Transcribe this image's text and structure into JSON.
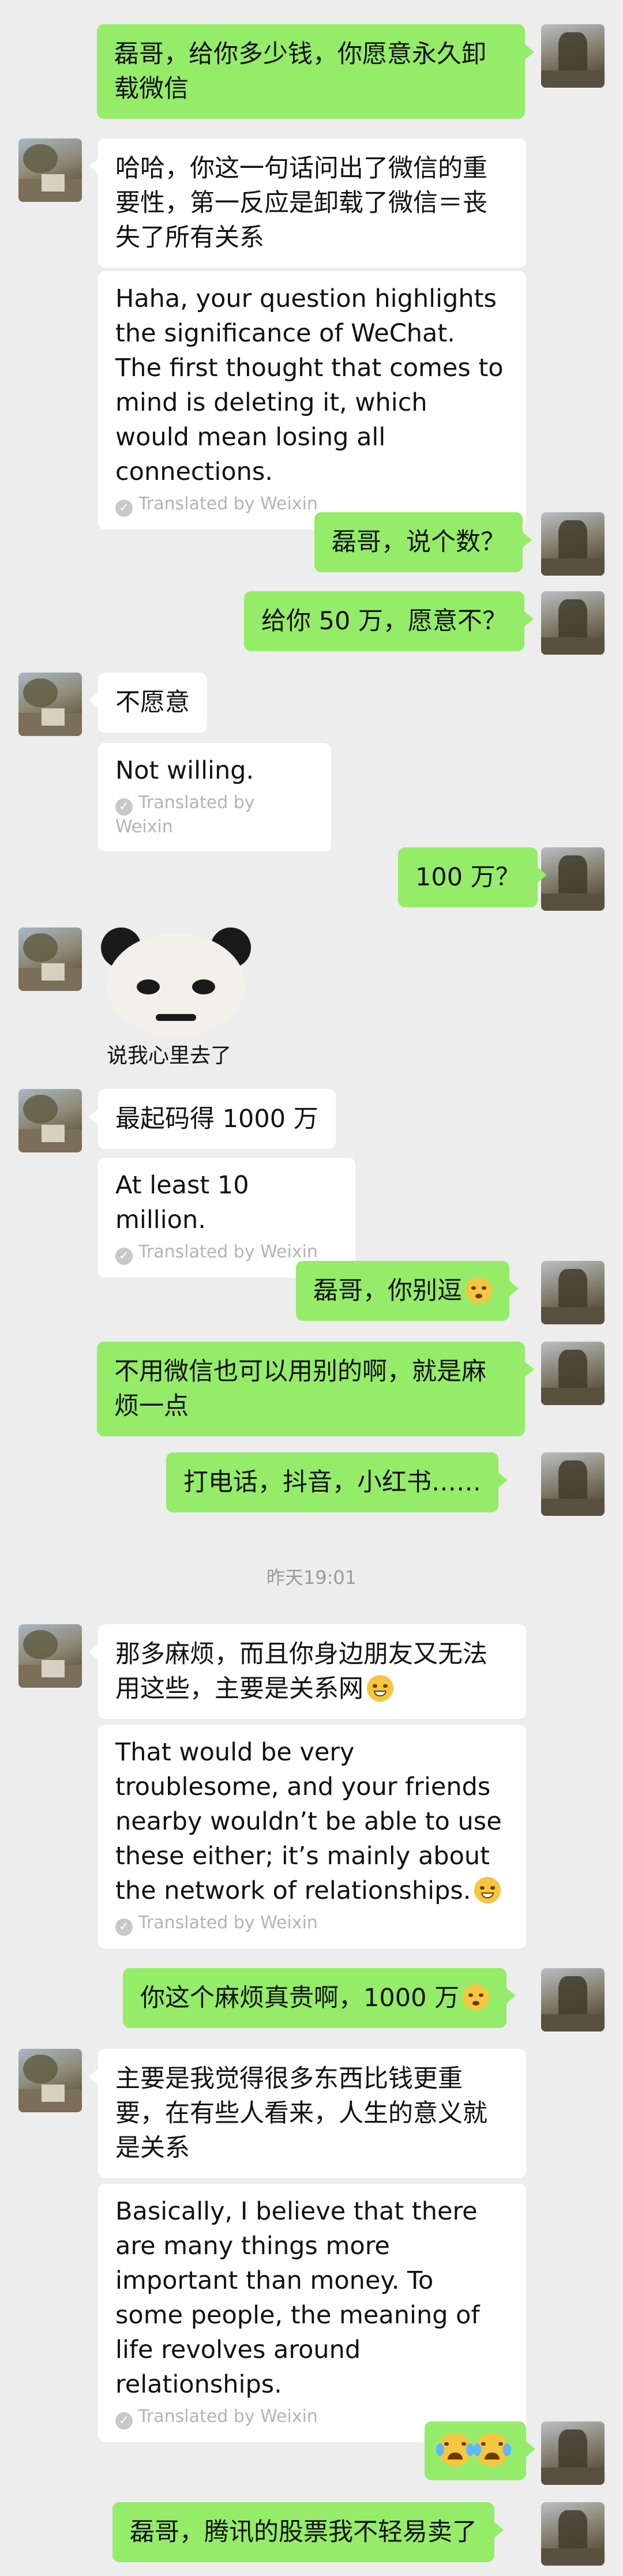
{
  "messages": [
    {
      "side": "right",
      "text": "磊哥，给你多少钱，你愿意永久卸载微信"
    },
    {
      "side": "left",
      "text": "哈哈，你这一句话问出了微信的重要性，第一反应是卸载了微信＝丧失了所有关系",
      "translation": "Haha, your question highlights the significance of WeChat. The first thought that comes to mind is deleting it, which would mean losing all connections."
    },
    {
      "side": "right",
      "text": "磊哥，说个数？"
    },
    {
      "side": "right",
      "text": "给你 50 万，愿意不？"
    },
    {
      "side": "left",
      "text": "不愿意",
      "translation": "Not willing."
    },
    {
      "side": "right",
      "text": "100 万？"
    },
    {
      "side": "left",
      "sticker_caption": "说我心里去了"
    },
    {
      "side": "left",
      "text": "最起码得 1000 万",
      "translation": "At least 10 million."
    },
    {
      "side": "right",
      "text": "磊哥，你别逗"
    },
    {
      "side": "right",
      "text": "不用微信也可以用别的啊，就是麻烦一点"
    },
    {
      "side": "right",
      "text": "打电话，抖音，小红书……"
    },
    {
      "side": "left",
      "text": "那多麻烦，而且你身边朋友又无法用这些，主要是关系网",
      "translation": "That would be very troublesome, and your friends nearby wouldn’t be able to use these either; it’s mainly about the network of relationships."
    },
    {
      "side": "right",
      "text": "你这个麻烦真贵啊，1000 万"
    },
    {
      "side": "left",
      "text": "主要是我觉得很多东西比钱更重要，在有些人看来，人生的意义就是关系",
      "translation": "Basically, I believe that there are many things more important than money. To some people, the meaning of life revolves around relationships."
    },
    {
      "side": "right",
      "text": ""
    },
    {
      "side": "right",
      "text": "磊哥，腾讯的股票我不轻易卖了"
    }
  ],
  "translated_by": "Translated by Weixin",
  "timestamp": "昨天19:01",
  "icons": [
    "avatar",
    "translate-check-icon",
    "grin-emoji",
    "flushed-emoji",
    "crying-laugh-emoji",
    "panda-meme-sticker"
  ]
}
